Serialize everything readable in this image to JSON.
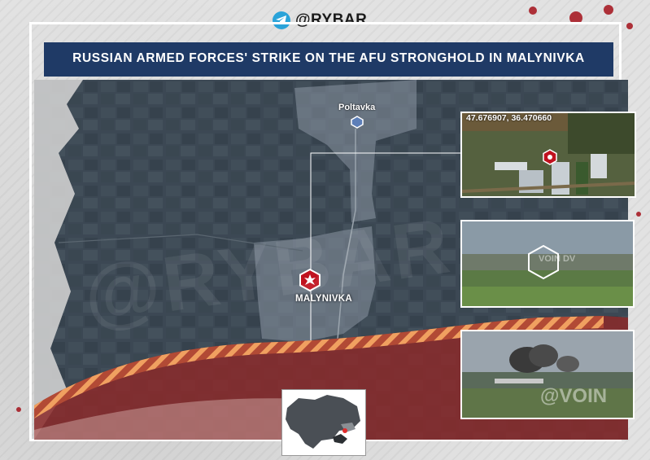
{
  "brand": {
    "handle": "@RYBAR"
  },
  "title": "RUSSIAN ARMED FORCES' STRIKE ON THE AFU STRONGHOLD IN MALYNIVKA",
  "map": {
    "towns": [
      {
        "name": "Poltavka"
      },
      {
        "name": "MALYNIVKA"
      }
    ],
    "watermark": "@RYBAR",
    "colors": {
      "settlement": "#8a96a3",
      "frontline_fill": "#8b2a2a",
      "frontline_stripe": "#e0873a",
      "strike_marker": "#c0121f"
    }
  },
  "insets": [
    {
      "coords": "47.676907, 36.470660",
      "icon": "strike-target-icon"
    },
    {
      "watermark": "VOIN DV"
    },
    {
      "watermark": "@VOIN"
    }
  ]
}
